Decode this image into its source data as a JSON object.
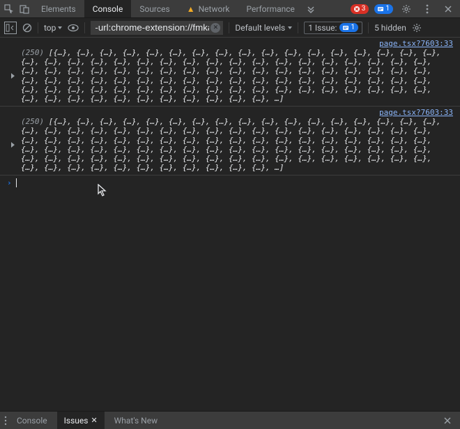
{
  "tabbar": {
    "tabs": [
      {
        "label": "Elements"
      },
      {
        "label": "Console"
      },
      {
        "label": "Sources"
      },
      {
        "label": "Network"
      },
      {
        "label": "Performance"
      }
    ],
    "active_tab_index": 1,
    "error_badge_count": "3",
    "info_badge_count": "1"
  },
  "toolbar": {
    "context_label": "top",
    "filter_value": "-url:chrome-extension://fmkadmapg",
    "levels_label": "Default levels",
    "issues_label": "1 Issue:",
    "issues_count": "1",
    "hidden_label": "5 hidden"
  },
  "console": {
    "messages": [
      {
        "source": "page.tsx?7603:33",
        "count": "(250)",
        "body": "[{…}, {…}, {…}, {…}, {…}, {…}, {…}, {…}, {…}, {…}, {…}, {…}, {…}, {…}, {…}, {…}, {…}, {…}, {…}, {…}, {…}, {…}, {…}, {…}, {…}, {…}, {…}, {…}, {…}, {…}, {…}, {…}, {…}, {…}, {…}, {…}, {…}, {…}, {…}, {…}, {…}, {…}, {…}, {…}, {…}, {…}, {…}, {…}, {…}, {…}, {…}, {…}, {…}, {…}, {…}, {…}, {…}, {…}, {…}, {…}, {…}, {…}, {…}, {…}, {…}, {…}, {…}, {…}, {…}, {…}, {…}, {…}, {…}, {…}, {…}, {…}, {…}, {…}, {…}, {…}, {…}, {…}, {…}, {…}, {…}, {…}, {…}, {…}, {…}, {…}, {…}, {…}, {…}, {…}, {…}, {…}, {…}, {…}, {…}, {…}, …]"
      },
      {
        "source": "page.tsx?7603:33",
        "count": "(250)",
        "body": "[{…}, {…}, {…}, {…}, {…}, {…}, {…}, {…}, {…}, {…}, {…}, {…}, {…}, {…}, {…}, {…}, {…}, {…}, {…}, {…}, {…}, {…}, {…}, {…}, {…}, {…}, {…}, {…}, {…}, {…}, {…}, {…}, {…}, {…}, {…}, {…}, {…}, {…}, {…}, {…}, {…}, {…}, {…}, {…}, {…}, {…}, {…}, {…}, {…}, {…}, {…}, {…}, {…}, {…}, {…}, {…}, {…}, {…}, {…}, {…}, {…}, {…}, {…}, {…}, {…}, {…}, {…}, {…}, {…}, {…}, {…}, {…}, {…}, {…}, {…}, {…}, {…}, {…}, {…}, {…}, {…}, {…}, {…}, {…}, {…}, {…}, {…}, {…}, {…}, {…}, {…}, {…}, {…}, {…}, {…}, {…}, {…}, {…}, {…}, {…}, …]"
      }
    ]
  },
  "drawer": {
    "tabs": [
      {
        "label": "Console"
      },
      {
        "label": "Issues"
      },
      {
        "label": "What's New"
      }
    ],
    "active_tab_index": 1
  }
}
